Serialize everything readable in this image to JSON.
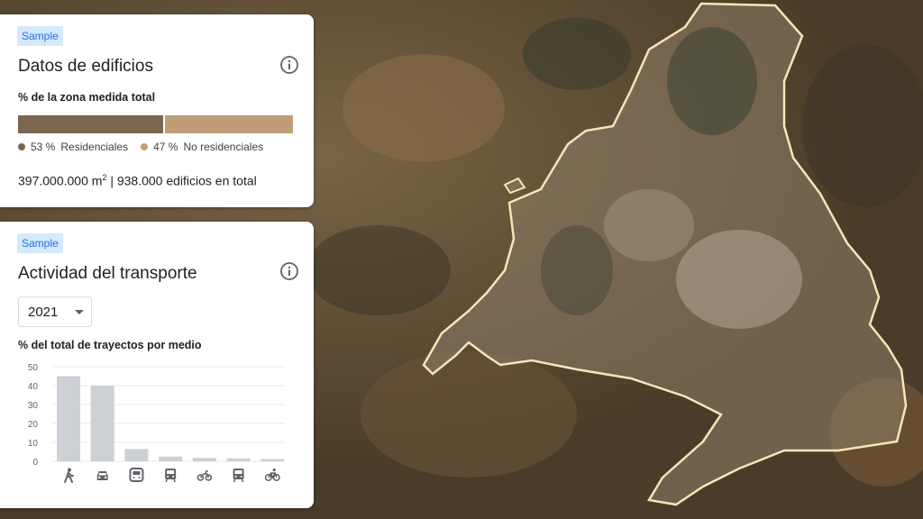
{
  "buildings": {
    "badge": "Sample",
    "title": "Datos de edificios",
    "subtitle": "% de la zona medida total",
    "residential": {
      "pct": 53,
      "pct_label": "53 %",
      "label": "Residenciales",
      "color": "#7b6650"
    },
    "non_residential": {
      "pct": 47,
      "pct_label": "47 %",
      "label": "No residenciales",
      "color": "#bf9e77"
    },
    "area_value": "397.000.000 m",
    "area_sup": "2",
    "separator": "|",
    "buildings_total": "938.000 edificios en total"
  },
  "transport": {
    "badge": "Sample",
    "title": "Actividad del transporte",
    "year": "2021",
    "subtitle": "% del total de trayectos por medio"
  },
  "colors": {
    "badge_bg": "#d6e8fb",
    "badge_text": "#1a73e8",
    "bar_gray": "#cdd0d4",
    "boundary": "#f5e6b8"
  },
  "icons": [
    "walk-icon",
    "car-icon",
    "bus-icon",
    "tram-icon",
    "motorcycle-icon",
    "train-icon",
    "bicycle-icon"
  ],
  "chart_data": {
    "type": "bar",
    "categories": [
      "walk",
      "car",
      "bus",
      "tram",
      "motorcycle",
      "train",
      "bicycle"
    ],
    "values": [
      45,
      40,
      6.5,
      2.5,
      1.8,
      1.6,
      1.2
    ],
    "ylim": [
      0,
      50
    ],
    "yticks": [
      0,
      10,
      20,
      30,
      40,
      50
    ],
    "grid": true
  }
}
